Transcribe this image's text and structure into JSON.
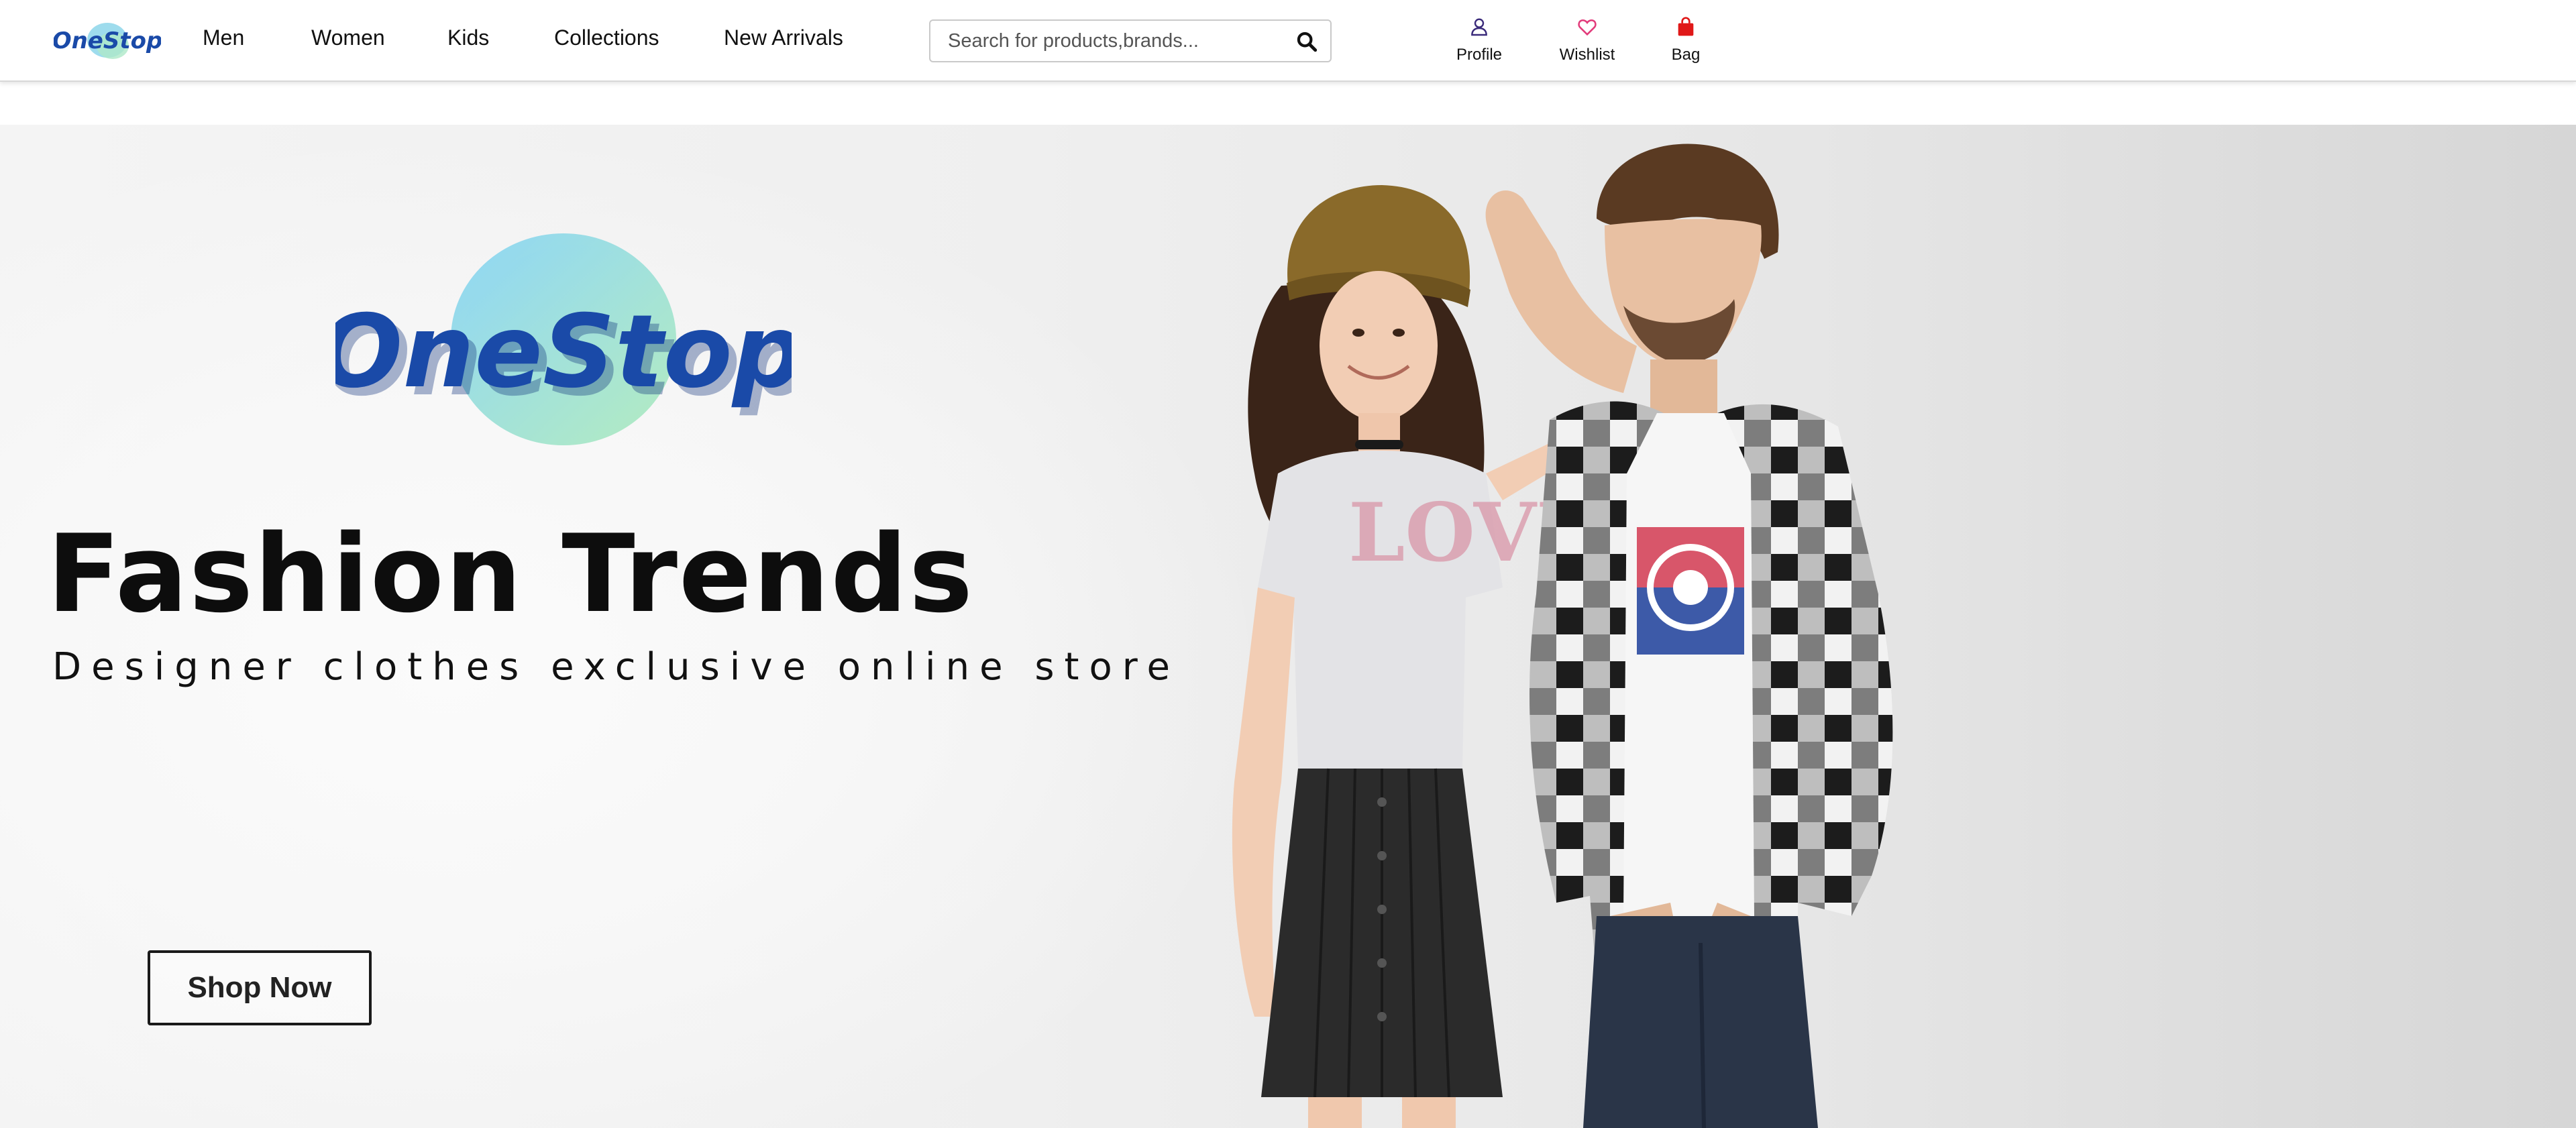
{
  "brand": {
    "name": "OneStop",
    "logo_color": "#1a4aa8",
    "splash_colors": [
      "#8fd6f0",
      "#a8e6c4"
    ]
  },
  "nav": {
    "links": [
      {
        "label": "Men"
      },
      {
        "label": "Women"
      },
      {
        "label": "Kids"
      },
      {
        "label": "Collections"
      },
      {
        "label": "New Arrivals"
      }
    ],
    "search": {
      "placeholder": "Search for products,brands...",
      "value": "",
      "icon": "search-icon"
    },
    "actions": [
      {
        "label": "Profile",
        "icon": "user-icon",
        "color": "#3a2a7a"
      },
      {
        "label": "Wishlist",
        "icon": "heart-icon",
        "color": "#e23a7a"
      },
      {
        "label": "Bag",
        "icon": "shopping-bag-icon",
        "color": "#e01818"
      }
    ]
  },
  "hero": {
    "title": "Fashion Trends",
    "subtitle": "Designer clothes exclusive online store",
    "cta_label": "Shop Now",
    "shirt_text": "LOVE"
  }
}
